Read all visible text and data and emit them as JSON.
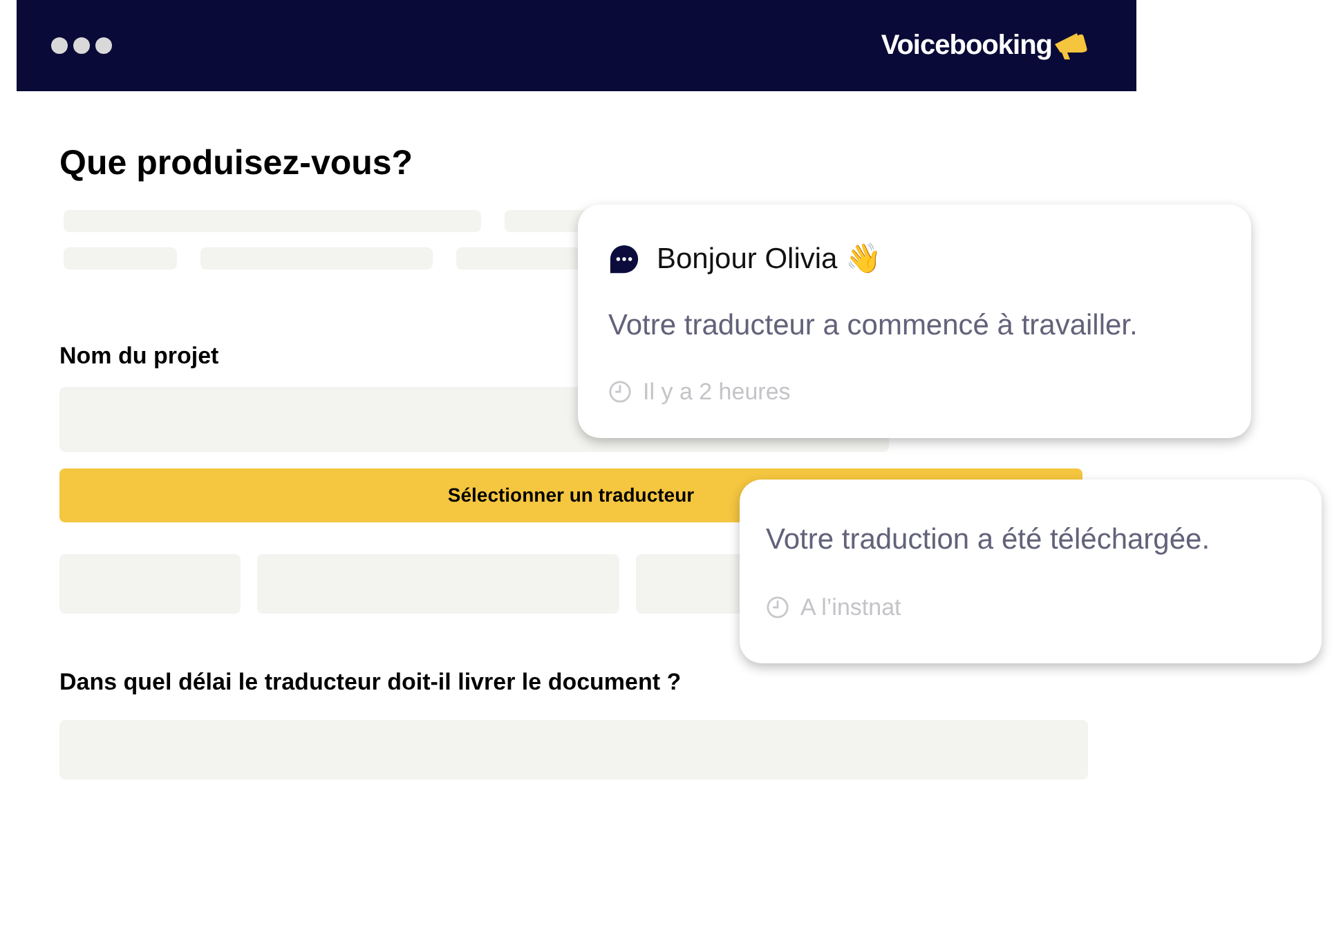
{
  "header": {
    "logo": "Voicebooking"
  },
  "form": {
    "title": "Que produisez-vous?",
    "project_label": "Nom du projet",
    "select_button": "Sélectionner un traducteur",
    "deadline_label": "Dans quel délai le traducteur doit-il livrer le document ?"
  },
  "notifications": [
    {
      "kind": "greeting",
      "title": "Bonjour Olivia 👋",
      "message": "Votre traducteur a commencé à travailler.",
      "time": "Il y a 2 heures"
    },
    {
      "kind": "plain",
      "message": "Votre traduction a été téléchargée.",
      "time": "A l’instnat"
    }
  ]
}
